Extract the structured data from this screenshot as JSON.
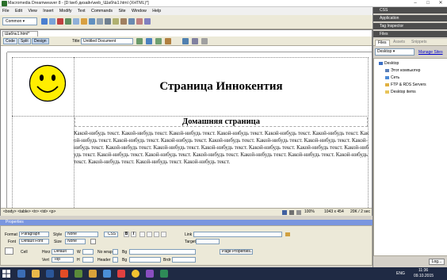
{
  "app": {
    "title": "Macromedia Dreamweaver 8 - [D:\\веб дизайн\\web_\\Шаб№1.html (XHTML)*]",
    "window_controls": [
      "–",
      "□",
      "✕"
    ]
  },
  "menu": [
    "File",
    "Edit",
    "View",
    "Insert",
    "Modify",
    "Text",
    "Commands",
    "Site",
    "Window",
    "Help"
  ],
  "insert_bar": {
    "category": "Common"
  },
  "document": {
    "tab_label": "Шаб№1.html*",
    "view_buttons": [
      "Code",
      "Split",
      "Design"
    ],
    "title_label": "Title:",
    "title_value": "Untitled Document",
    "page_heading": "Страница Иннокентия",
    "section_heading": "Домашняя страница",
    "body_text": "Какой-нибудь текст. Какой-нибудь текст. Какой-нибудь текст. Какой-нибудь текст. Какой-нибудь текст. Какой-нибудь текст. Какой-нибудь текст. Какой-нибудь текст. Какой-нибудь текст. Какой-нибудь текст. Какой-нибудь текст. Какой-нибудь текст. Какой-нибудь текст. Какой-нибудь текст. Какой-нибудь текст. Какой-нибудь текст. Какой-нибудь текст. Какой-нибудь текст. Какой-нибудь текст. Какой-нибудь текст. Какой-нибудь текст. Какой-нибудь текст. Какой-нибудь текст. Какой-нибудь текст. Какой-нибудь текст. Какой-нибудь текст. Какой-нибудь текст. Какой-нибудь текст."
  },
  "status_bar": {
    "tag_path": "<body> <table> <tr> <td> <p>",
    "zoom": "100%",
    "window_size": "1043 x 454",
    "file_info": "20K / 2 sec"
  },
  "properties": {
    "panel_title": "Properties",
    "format_label": "Format",
    "format_value": "Paragraph",
    "style_label": "Style",
    "style_value": "None",
    "css_button": "CSS",
    "bold": "B",
    "italic": "I",
    "link_label": "Link",
    "font_label": "Font",
    "font_value": "Default Font",
    "size_label": "Size",
    "size_value": "None",
    "target_label": "Target",
    "cell_label": "Cell",
    "horz_label": "Horz",
    "horz_value": "Default",
    "vert_label": "Vert",
    "vert_value": "Top",
    "w_label": "W",
    "h_label": "H",
    "nowrap_label": "No wrap",
    "header_label": "Header",
    "bg_label": "Bg",
    "brdr_label": "Brdr",
    "page_properties_button": "Page Properties..."
  },
  "right_panels": {
    "groups": [
      "CSS",
      "Application",
      "Tag Inspector",
      "Files"
    ],
    "file_tabs": [
      "Files",
      "Assets",
      "Snippets"
    ],
    "site_select": "Desktop",
    "manage_sites": "Manage Sites",
    "tree": [
      {
        "label": "Desktop",
        "indent": 0,
        "color": "#3a6fc4"
      },
      {
        "label": "Этот компьютер",
        "indent": 1,
        "color": "#5a7fb8"
      },
      {
        "label": "Сеть",
        "indent": 1,
        "color": "#4d8ad6"
      },
      {
        "label": "FTP & RDS Servers",
        "indent": 1,
        "color": "#e0b040"
      },
      {
        "label": "Desktop items",
        "indent": 1,
        "color": "#e8c45a"
      }
    ],
    "log_button": "Log..."
  },
  "taskbar": {
    "lang": "ENG",
    "time": "11:36",
    "date": "09.10.2015"
  },
  "colors": {
    "panel_header": "#4d4d4d",
    "properties_header": "#7a96df",
    "smiley_fill": "#ffee00",
    "taskbar": "#1f2a44"
  }
}
